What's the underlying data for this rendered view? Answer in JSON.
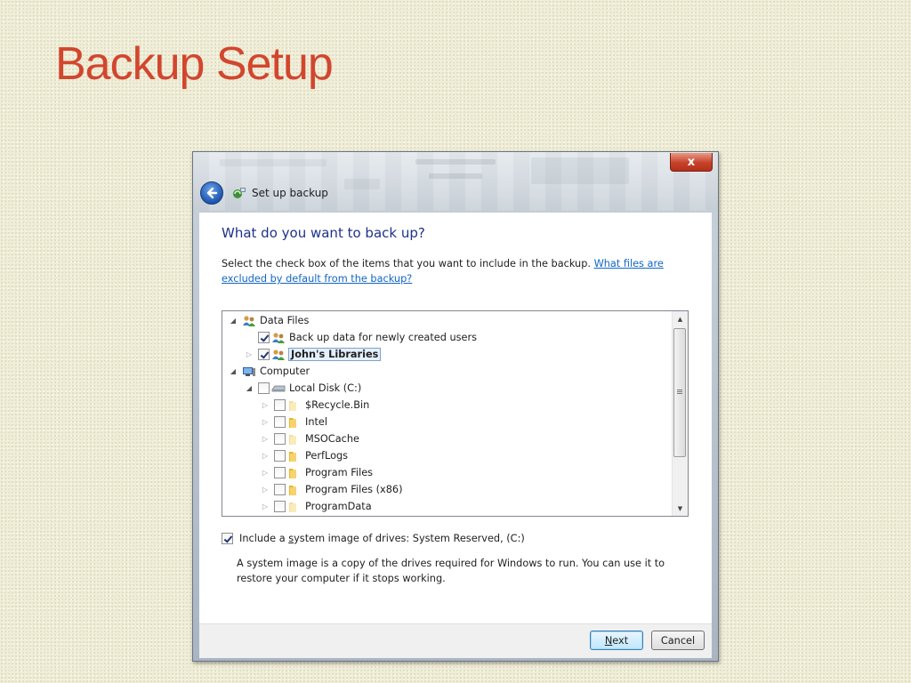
{
  "slide": {
    "title": "Backup Setup"
  },
  "window": {
    "title": "Set up backup",
    "close_label": "x"
  },
  "content": {
    "heading": "What do you want to back up?",
    "description": "Select the check box of the items that you want to include in the backup.",
    "excluded_link": "What files are excluded by default from the backup?"
  },
  "tree": {
    "items": [
      {
        "label": "Data Files",
        "level": 0,
        "expander": "expanded",
        "checkbox": "none",
        "icon": "users-icon"
      },
      {
        "label": "Back up data for newly created users",
        "level": 1,
        "expander": "none",
        "checkbox": "checked",
        "icon": "users-icon"
      },
      {
        "label": "John's Libraries",
        "level": 1,
        "expander": "collapsed",
        "checkbox": "checked",
        "icon": "users-icon",
        "bold": true,
        "selected": true
      },
      {
        "label": "Computer",
        "level": 0,
        "expander": "expanded",
        "checkbox": "none",
        "icon": "computer-icon"
      },
      {
        "label": "Local Disk (C:)",
        "level": 1,
        "expander": "expanded",
        "checkbox": "unchecked",
        "icon": "drive-icon"
      },
      {
        "label": "$Recycle.Bin",
        "level": 2,
        "expander": "collapsed",
        "checkbox": "unchecked",
        "icon": "folder-icon",
        "faded": true
      },
      {
        "label": "Intel",
        "level": 2,
        "expander": "collapsed",
        "checkbox": "unchecked",
        "icon": "folder-icon"
      },
      {
        "label": "MSOCache",
        "level": 2,
        "expander": "collapsed",
        "checkbox": "unchecked",
        "icon": "folder-icon",
        "faded": true
      },
      {
        "label": "PerfLogs",
        "level": 2,
        "expander": "collapsed",
        "checkbox": "unchecked",
        "icon": "folder-icon"
      },
      {
        "label": "Program Files",
        "level": 2,
        "expander": "collapsed",
        "checkbox": "unchecked",
        "icon": "folder-icon"
      },
      {
        "label": "Program Files (x86)",
        "level": 2,
        "expander": "collapsed",
        "checkbox": "unchecked",
        "icon": "folder-icon"
      },
      {
        "label": "ProgramData",
        "level": 2,
        "expander": "collapsed",
        "checkbox": "unchecked",
        "icon": "folder-icon",
        "faded": true
      }
    ]
  },
  "system_image": {
    "checked": true,
    "label_pre": "Include a ",
    "label_key": "s",
    "label_post": "ystem image of drives: System Reserved, (C:)",
    "description": "A system image is a copy of the drives required for Windows to run. You can use it to restore your computer if it stops working."
  },
  "buttons": {
    "next_key": "N",
    "next_rest": "ext",
    "cancel": "Cancel"
  },
  "colors": {
    "slide_title": "#d2462e",
    "heading": "#1e3287",
    "link": "#1266c4",
    "folder": "#e8b62c"
  }
}
